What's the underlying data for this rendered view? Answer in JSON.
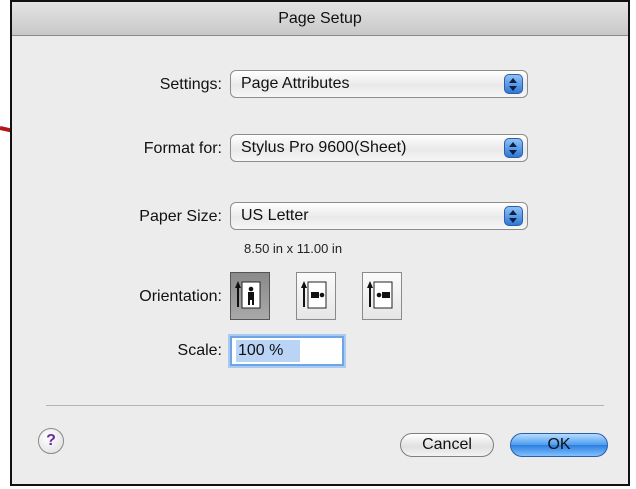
{
  "window": {
    "title": "Page Setup"
  },
  "settings": {
    "label": "Settings:",
    "value": "Page Attributes"
  },
  "format_for": {
    "label": "Format for:",
    "value": "Stylus Pro 9600(Sheet)"
  },
  "paper_size": {
    "label": "Paper Size:",
    "value": "US Letter",
    "dimensions": "8.50 in x 11.00 in"
  },
  "orientation": {
    "label": "Orientation:",
    "options": [
      {
        "icon": "portrait-orientation-icon",
        "selected": true
      },
      {
        "icon": "landscape-orientation-icon",
        "selected": false
      },
      {
        "icon": "reverse-landscape-orientation-icon",
        "selected": false
      }
    ]
  },
  "scale": {
    "label": "Scale:",
    "value": "100 %"
  },
  "buttons": {
    "help_label": "?",
    "cancel_label": "Cancel",
    "ok_label": "OK"
  },
  "annotation": {
    "arrow_color": "#b01818",
    "icon": "red-arrow-icon"
  },
  "colors": {
    "accent": "#4b9cf0",
    "dialog_bg": "#ececec"
  }
}
